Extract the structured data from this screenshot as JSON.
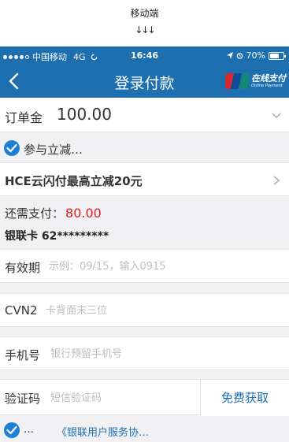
{
  "caption": "移动端",
  "arrows": "↓↓↓",
  "status_bar": {
    "carrier": "中国移动",
    "network": "4G",
    "time": "16:46",
    "battery": "70%",
    "battery_level": 0.7
  },
  "nav": {
    "title": "登录付款",
    "brand_cn": "在线支付",
    "brand_en": "Online Payment"
  },
  "order": {
    "label": "订单金",
    "amount": "100.00"
  },
  "discount": {
    "label": "参与立减…"
  },
  "promo": {
    "text": "HCE云闪付最高立减20元"
  },
  "payment": {
    "due_label": "还需支付：",
    "due_amount": "80.00",
    "card": "银联卡 62*********"
  },
  "fields": {
    "expiry": {
      "label": "有效期",
      "placeholder": "示例：09/15，输入0915"
    },
    "cvn2": {
      "label": "CVN2",
      "placeholder": "卡背面末三位"
    },
    "phone": {
      "label": "手机号",
      "placeholder": "银行预留手机号"
    },
    "code": {
      "label": "验证码",
      "placeholder": "短信验证码",
      "button": "免费获取"
    }
  },
  "agreement": {
    "dots": "…",
    "link": "《银联用户服务协…"
  },
  "colors": {
    "brand_blue": "#1e6fb0",
    "check_blue": "#1e7fd6",
    "amount_red": "#e02020"
  }
}
